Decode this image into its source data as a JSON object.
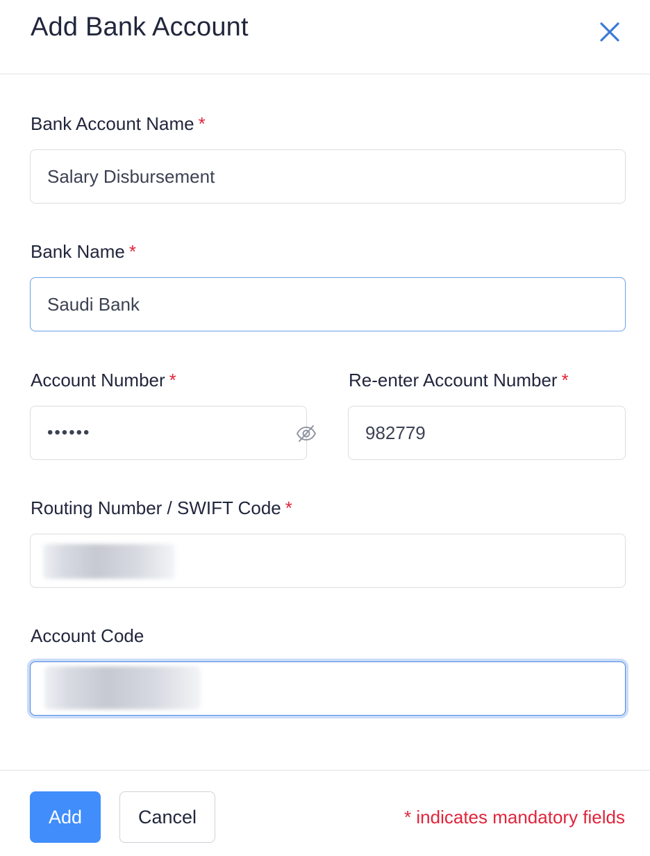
{
  "modal": {
    "title": "Add Bank Account"
  },
  "form": {
    "required_marker": "*",
    "bank_account_name": {
      "label": "Bank Account Name",
      "value": "Salary Disbursement"
    },
    "bank_name": {
      "label": "Bank Name",
      "value": "Saudi Bank"
    },
    "account_number": {
      "label": "Account Number",
      "value": "••••••"
    },
    "reenter_account_number": {
      "label": "Re-enter Account Number",
      "value": "982779"
    },
    "routing_number": {
      "label": "Routing Number / SWIFT Code"
    },
    "account_code": {
      "label": "Account Code"
    }
  },
  "footer": {
    "add_label": "Add",
    "cancel_label": "Cancel",
    "mandatory_note": "* indicates mandatory fields"
  },
  "colors": {
    "accent": "#408dfb",
    "required": "#e0243b",
    "close_icon": "#3a7bd5"
  },
  "icons": {
    "close": "close-icon",
    "password_visibility": "eye-slash-icon"
  }
}
